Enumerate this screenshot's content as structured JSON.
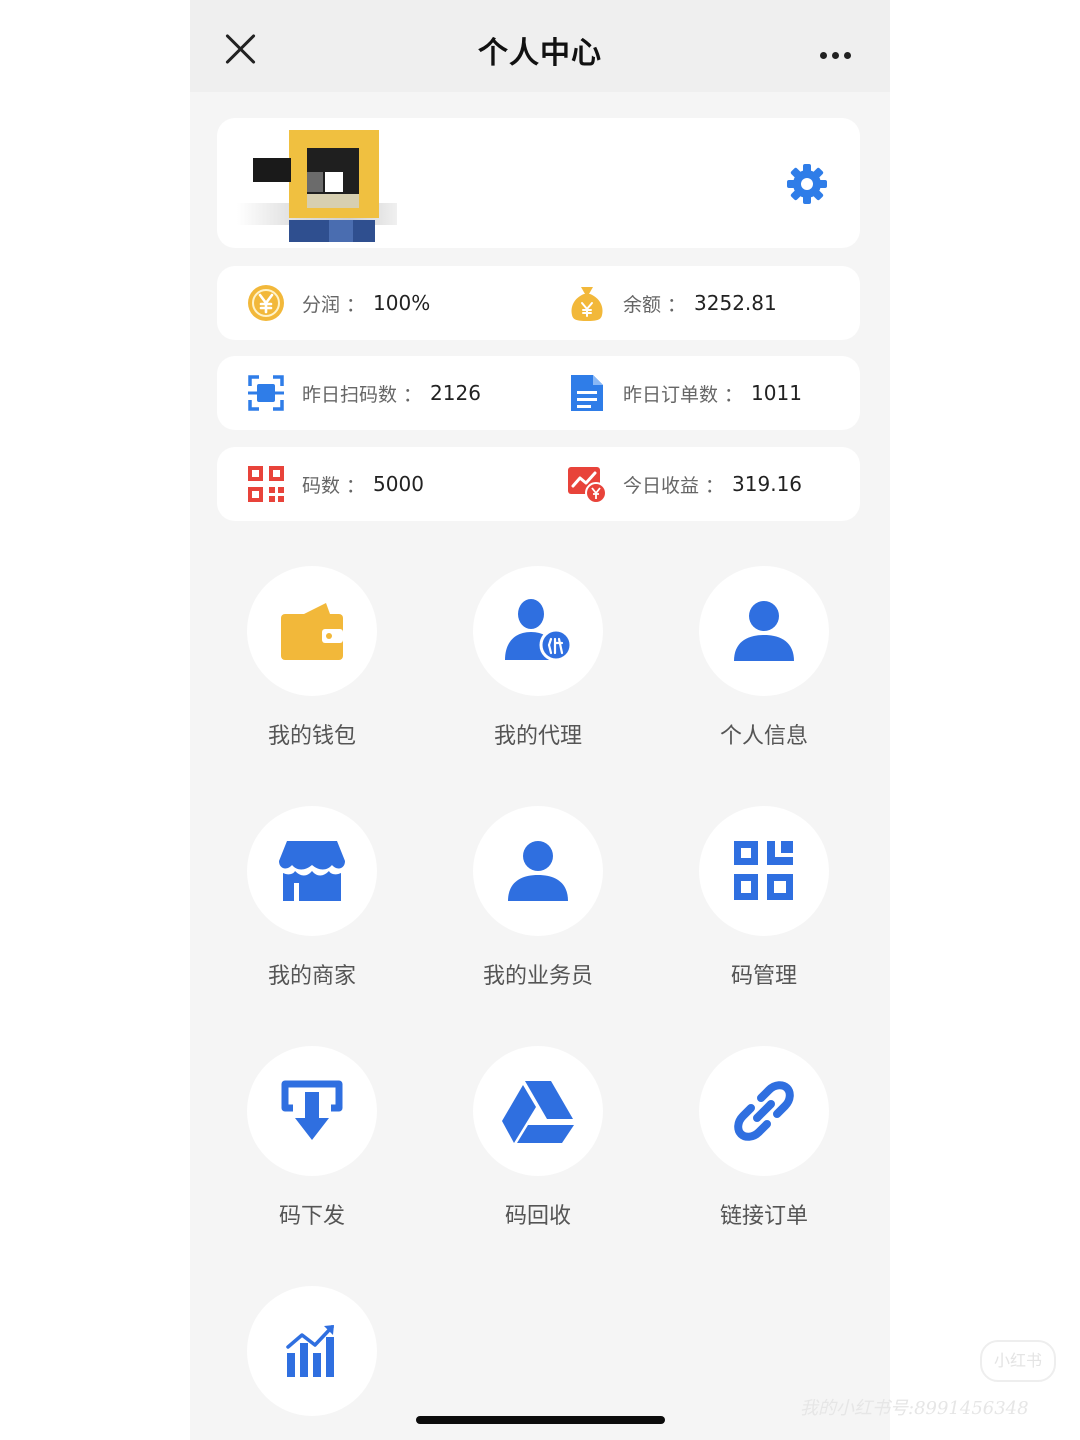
{
  "header": {
    "title": "个人中心"
  },
  "stats": [
    {
      "left": {
        "label": "分润",
        "sep": "：",
        "value": "100%"
      },
      "right": {
        "label": "余额",
        "sep": "：",
        "value": "3252.81"
      }
    },
    {
      "left": {
        "label": "昨日扫码数",
        "sep": "：",
        "value": "2126"
      },
      "right": {
        "label": "昨日订单数",
        "sep": "：",
        "value": "1011"
      }
    },
    {
      "left": {
        "label": "码数",
        "sep": "：",
        "value": "5000"
      },
      "right": {
        "label": "今日收益",
        "sep": "：",
        "value": "319.16"
      }
    }
  ],
  "menu": [
    {
      "label": "我的钱包",
      "icon": "wallet-icon"
    },
    {
      "label": "我的代理",
      "icon": "agent-icon"
    },
    {
      "label": "个人信息",
      "icon": "person-icon"
    },
    {
      "label": "我的商家",
      "icon": "store-icon"
    },
    {
      "label": "我的业务员",
      "icon": "person-icon"
    },
    {
      "label": "码管理",
      "icon": "qr-grid-icon"
    },
    {
      "label": "码下发",
      "icon": "download-icon"
    },
    {
      "label": "码回收",
      "icon": "drive-triangle-icon"
    },
    {
      "label": "链接订单",
      "icon": "link-icon"
    },
    {
      "label": "",
      "icon": "bar-chart-icon"
    }
  ],
  "colors": {
    "accent": "#2f6fe0",
    "gold": "#f2b83a",
    "red": "#e8433a",
    "page_bg": "#f5f5f5"
  },
  "watermark": {
    "logo": "小红书",
    "text": "我的小红书号:8991456348"
  }
}
